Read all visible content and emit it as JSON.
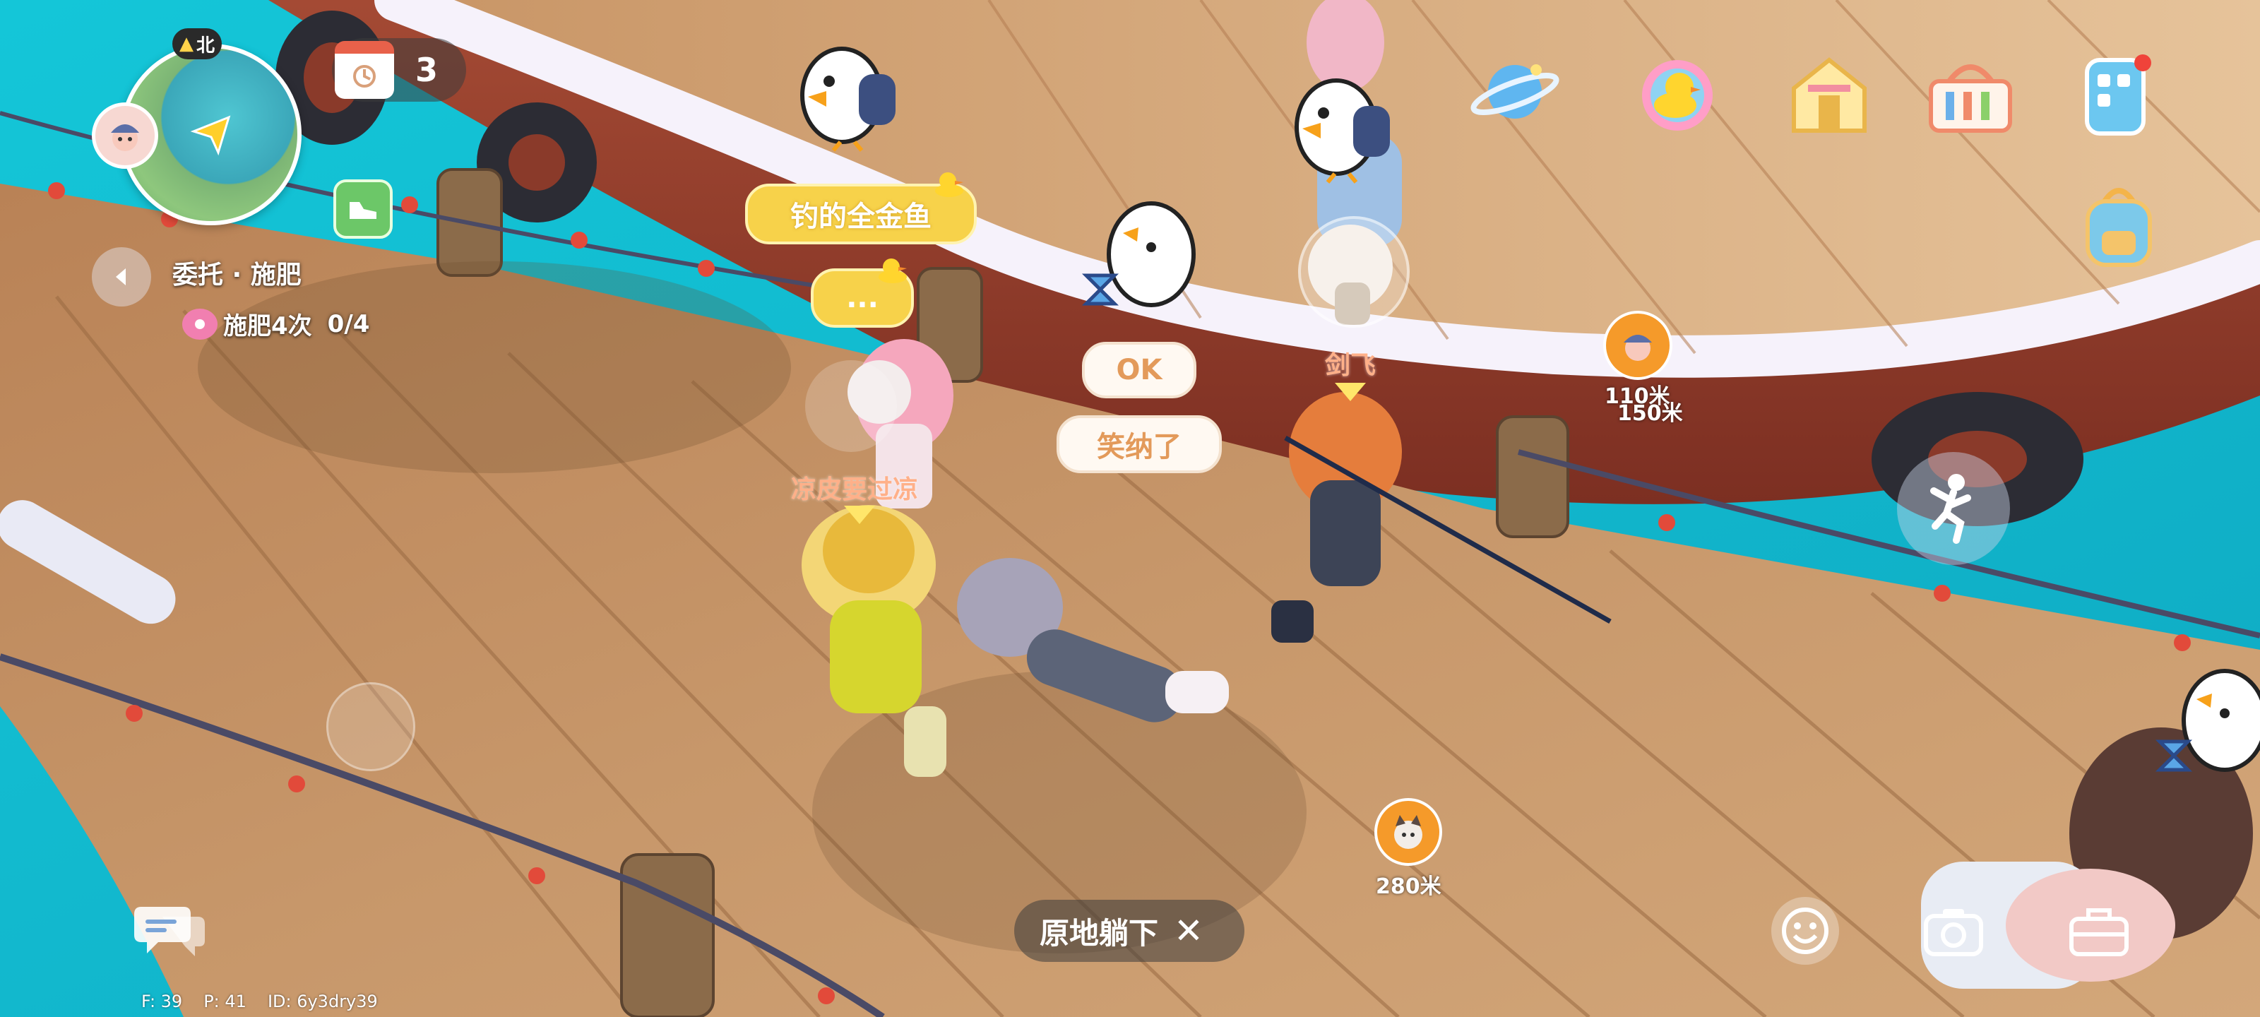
{
  "minimap": {
    "north_label": "北",
    "icon": "minimap"
  },
  "calendar": {
    "count": "3",
    "icon": "calendar-icon"
  },
  "quest": {
    "title": "委托 · 施肥",
    "progress_label": "施肥4次",
    "progress_count": "0/4",
    "progress_value": 0,
    "progress_max": 4
  },
  "chat_bubbles": {
    "fish_message": "钓的全金鱼",
    "typing_message": "...",
    "ok_message": "OK",
    "accept_message": "笑纳了"
  },
  "players": {
    "name_1": "凉皮要过凉",
    "name_2": "剑飞"
  },
  "markers": {
    "marker_1_distance_a": "110米",
    "marker_1_distance_b": "150米",
    "marker_2_distance": "280米"
  },
  "top_icons": [
    "planet-icon",
    "duck-icon",
    "gift-house-icon",
    "shopping-basket-icon",
    "phone-icon",
    "backpack-icon"
  ],
  "action_prompt": {
    "label": "原地躺下"
  },
  "debug_info": {
    "f": "F: 39",
    "p": "P: 41",
    "id": "ID: 6y3dry39"
  },
  "colors": {
    "sea": "#19b8cc",
    "deck": "#c08a5a",
    "bubble_yellow": "#f7d24a",
    "accent_orange": "#f59a2a"
  }
}
